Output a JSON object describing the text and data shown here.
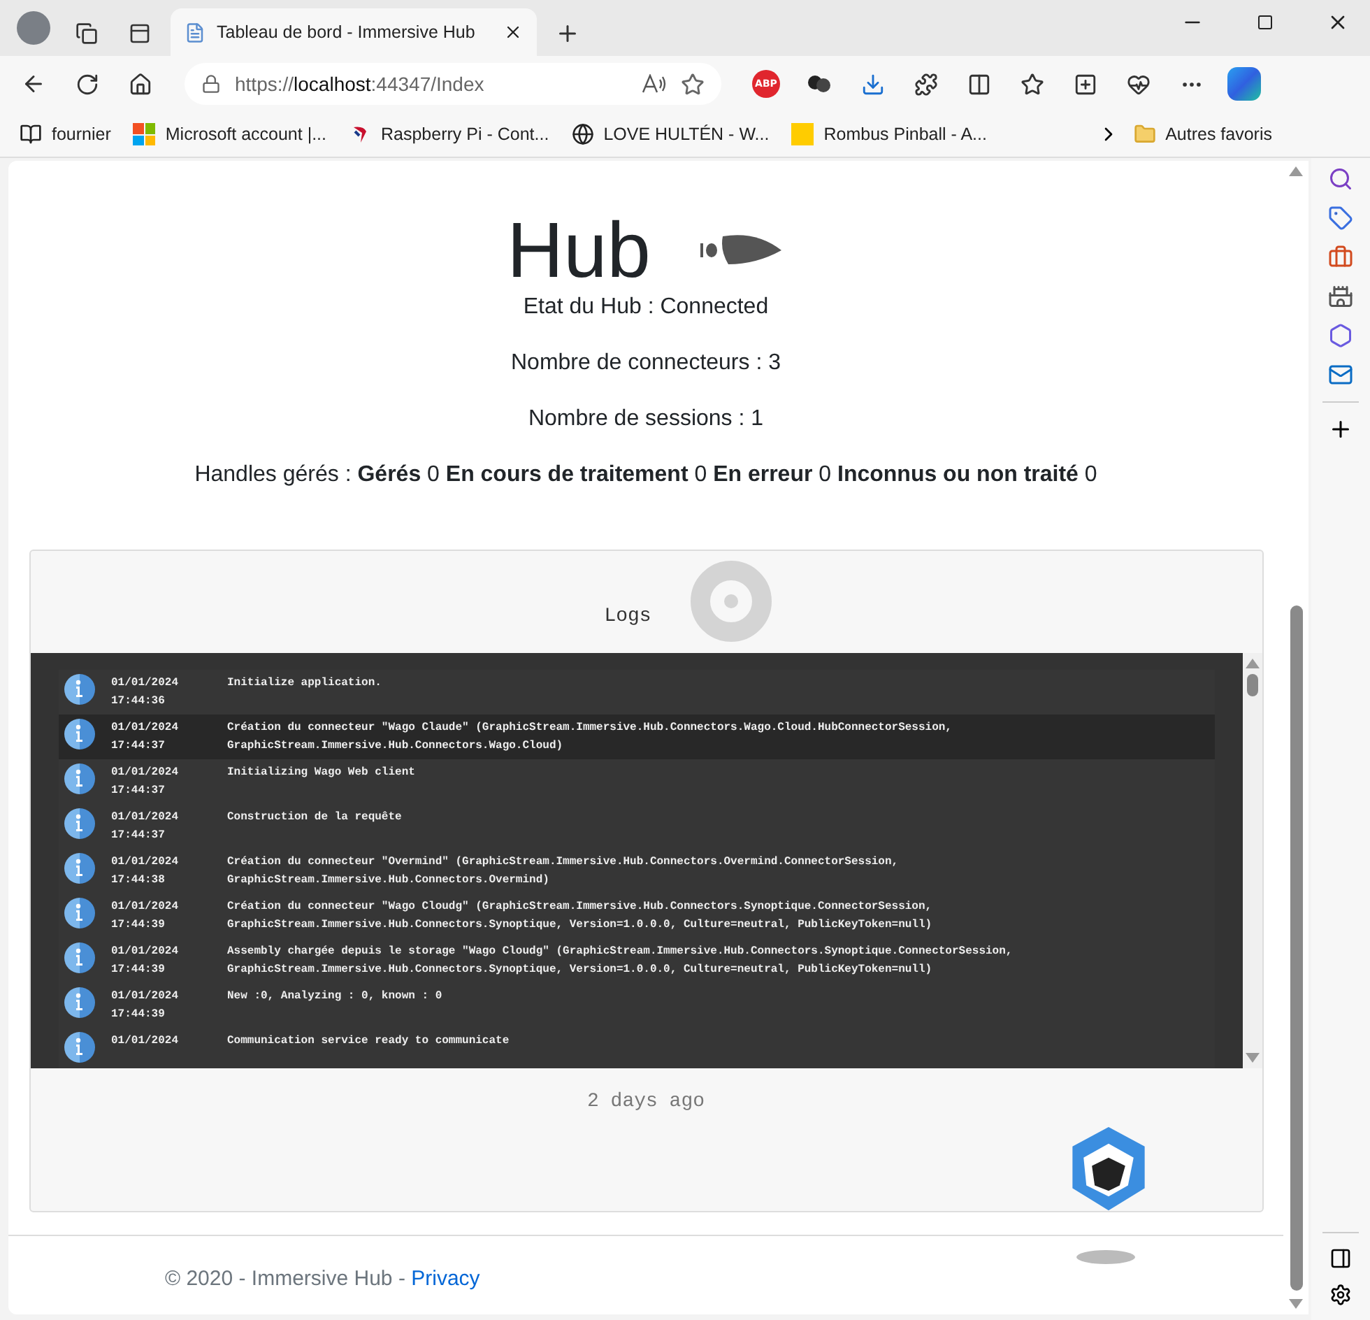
{
  "browser": {
    "tabs": [
      {
        "title": "Tableau de bord - Immersive Hub",
        "selected": true
      }
    ],
    "address": {
      "scheme": "https://",
      "host": "localhost",
      "rest": ":44347/Index"
    },
    "extension_badge": "ABP",
    "bookmarks": [
      {
        "label": "fournier",
        "kind": "reader"
      },
      {
        "label": "Microsoft account |...",
        "kind": "microsoft"
      },
      {
        "label": "Raspberry Pi - Cont...",
        "kind": "raspberry"
      },
      {
        "label": "LOVE HULTÉN - W...",
        "kind": "globe"
      },
      {
        "label": "Rombus Pinball - A...",
        "kind": "square"
      }
    ],
    "other_favorites": "Autres favoris"
  },
  "page": {
    "title": "Hub",
    "stats": [
      "Etat du Hub : Connected",
      "Nombre de connecteurs : 3",
      "Nombre de sessions : 1"
    ],
    "handles": "Handles gérés : **Gérés** 0 **En cours de traitement** 0 **En erreur** 0 **Inconnus ou non traité** 0",
    "logs": {
      "title": "Logs",
      "entries": [
        {
          "kind": "info",
          "date": "01/01/2024",
          "time": "17:44:36",
          "highlighted": false,
          "lines": [
            "Initialize application."
          ]
        },
        {
          "kind": "info",
          "date": "01/01/2024",
          "time": "17:44:37",
          "highlighted": true,
          "lines": [
            "Création du connecteur \"Wago Claude\" (GraphicStream.Immersive.Hub.Connectors.Wago.Cloud.HubConnectorSession,",
            "GraphicStream.Immersive.Hub.Connectors.Wago.Cloud)"
          ]
        },
        {
          "kind": "info",
          "date": "01/01/2024",
          "time": "17:44:37",
          "highlighted": false,
          "lines": [
            "Initializing Wago Web client"
          ]
        },
        {
          "kind": "info",
          "date": "01/01/2024",
          "time": "17:44:37",
          "highlighted": false,
          "lines": [
            "Construction de la requête"
          ]
        },
        {
          "kind": "info",
          "date": "01/01/2024",
          "time": "17:44:38",
          "highlighted": false,
          "lines": [
            "Création du connecteur \"Overmind\" (GraphicStream.Immersive.Hub.Connectors.Overmind.ConnectorSession,",
            "GraphicStream.Immersive.Hub.Connectors.Overmind)"
          ]
        },
        {
          "kind": "info",
          "date": "01/01/2024",
          "time": "17:44:39",
          "highlighted": false,
          "lines": [
            "Création du connecteur \"Wago Cloudg\" (GraphicStream.Immersive.Hub.Connectors.Synoptique.ConnectorSession,",
            "GraphicStream.Immersive.Hub.Connectors.Synoptique, Version=1.0.0.0, Culture=neutral, PublicKeyToken=null)"
          ]
        },
        {
          "kind": "info",
          "date": "01/01/2024",
          "time": "17:44:39",
          "highlighted": false,
          "lines": [
            "Assembly chargée depuis le storage \"Wago Cloudg\" (GraphicStream.Immersive.Hub.Connectors.Synoptique.ConnectorSession,",
            "GraphicStream.Immersive.Hub.Connectors.Synoptique, Version=1.0.0.0, Culture=neutral, PublicKeyToken=null)"
          ]
        },
        {
          "kind": "info",
          "date": "01/01/2024",
          "time": "17:44:39",
          "highlighted": false,
          "lines": [
            "New :0, Analyzing : 0, known : 0"
          ]
        },
        {
          "kind": "info",
          "date": "01/01/2024",
          "highlighted": false,
          "lines": [
            "Communication service ready to communicate"
          ]
        }
      ],
      "updated": "2 days ago"
    },
    "footer": {
      "text": "© 2020 - Immersive Hub - ",
      "link": "Privacy"
    }
  }
}
